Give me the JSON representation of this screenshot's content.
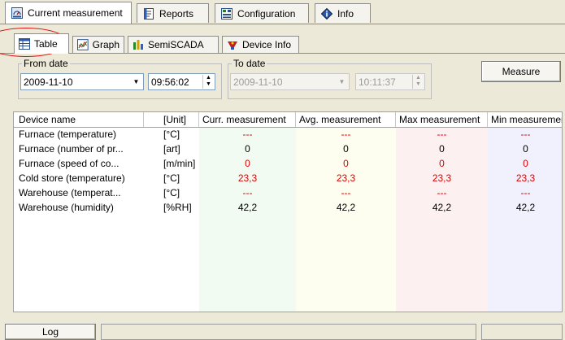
{
  "main_tabs": [
    {
      "label": "Current measurement",
      "icon": "gauge-icon",
      "active": true
    },
    {
      "label": "Reports",
      "icon": "report-icon",
      "active": false
    },
    {
      "label": "Configuration",
      "icon": "configuration-icon",
      "active": false
    },
    {
      "label": "Info",
      "icon": "info-icon",
      "active": false
    }
  ],
  "sub_tabs": [
    {
      "label": "Table",
      "icon": "table-icon",
      "active": true
    },
    {
      "label": "Graph",
      "icon": "graph-icon",
      "active": false
    },
    {
      "label": "SemiSCADA",
      "icon": "semiscada-icon",
      "active": false
    },
    {
      "label": "Device Info",
      "icon": "device-info-icon",
      "active": false
    }
  ],
  "from_date": {
    "label": "From date",
    "date": "2009-11-10",
    "time": "09:56:02"
  },
  "to_date": {
    "label": "To date",
    "date": "2009-11-10",
    "time": "10:11:37"
  },
  "measure_button": "Measure",
  "table": {
    "columns": [
      "Device name",
      "[Unit]",
      "Curr. measurement",
      "Avg. measurement",
      "Max measurement",
      "Min measurement"
    ],
    "rows": [
      {
        "name": "Furnace (temperature)",
        "unit": "[°C]",
        "curr": "---",
        "avg": "---",
        "max": "---",
        "min": "---",
        "alert": true
      },
      {
        "name": "Furnace (number of pr...",
        "unit": "[art]",
        "curr": "0",
        "avg": "0",
        "max": "0",
        "min": "0",
        "alert": false
      },
      {
        "name": "Furnace (speed of co...",
        "unit": "[m/min]",
        "curr": "0",
        "avg": "0",
        "max": "0",
        "min": "0",
        "alert": true
      },
      {
        "name": "Cold store (temperature)",
        "unit": "[°C]",
        "curr": "23,3",
        "avg": "23,3",
        "max": "23,3",
        "min": "23,3",
        "alert": true
      },
      {
        "name": "Warehouse (temperat...",
        "unit": "[°C]",
        "curr": "---",
        "avg": "---",
        "max": "---",
        "min": "---",
        "alert": true
      },
      {
        "name": "Warehouse (humidity)",
        "unit": "[%RH]",
        "curr": "42,2",
        "avg": "42,2",
        "max": "42,2",
        "min": "42,2",
        "alert": false
      }
    ]
  },
  "log_button": "Log",
  "colors": {
    "curr_col": "#f2fbf2",
    "avg_col": "#fdfdf0",
    "max_col": "#fdf0f0",
    "min_col": "#f0f1fc",
    "alert_red": "#e00000"
  }
}
